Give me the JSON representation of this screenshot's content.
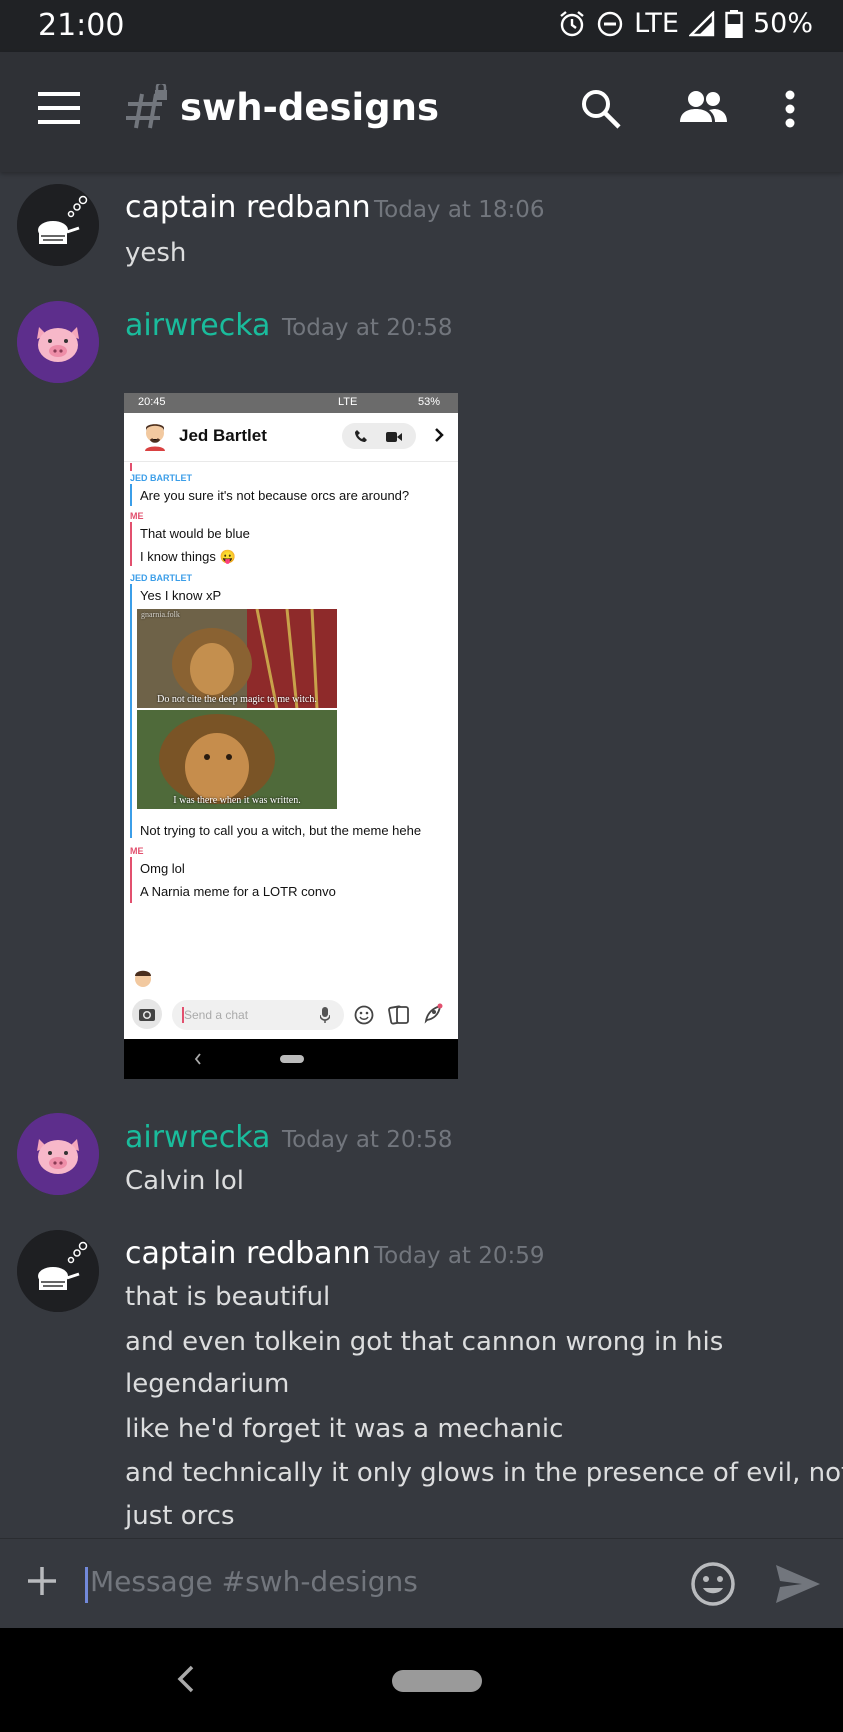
{
  "status": {
    "time": "21:00",
    "network": "LTE",
    "battery": "50%"
  },
  "header": {
    "channel": "swh-designs"
  },
  "messages": [
    {
      "user": "captain redbann",
      "time": "Today at 18:06",
      "lines": [
        "yesh"
      ]
    },
    {
      "user": "airwrecka",
      "time": "Today at 20:58"
    },
    {
      "user": "airwrecka",
      "time": "Today at 20:58",
      "lines": [
        "Calvin lol"
      ]
    },
    {
      "user": "captain redbann",
      "time": "Today at 20:59",
      "lines": [
        "that is beautiful",
        "and even tolkein got that cannon wrong in his",
        "legendarium",
        "like he'd forget it was a mechanic",
        "and technically it only glows in the presence of evil, not",
        "just orcs"
      ]
    }
  ],
  "attachment": {
    "status_time": "20:45",
    "status_network": "LTE",
    "status_battery": "53%",
    "contact": "Jed Bartlet",
    "label_jed": "JED BARTLET",
    "label_me": "ME",
    "lines": [
      "Are you sure it's not because orcs are around?",
      "That would be blue",
      "I know things 😛",
      "Yes I know xP",
      "Not trying to call you a witch, but the meme hehe",
      "Omg lol",
      "A Narnia meme for a LOTR convo"
    ],
    "meme_watermark": "gnarnia.folk",
    "meme_top": "Do not cite the deep magic to me witch.",
    "meme_bottom": "I was there when it was written.",
    "input_placeholder": "Send a chat"
  },
  "composer": {
    "placeholder": "Message #swh-designs"
  }
}
